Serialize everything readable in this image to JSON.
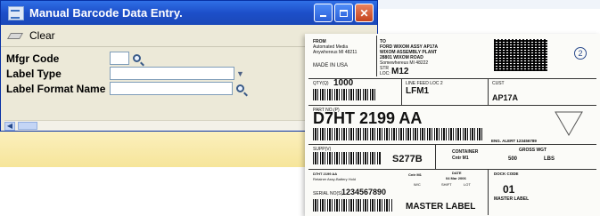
{
  "window": {
    "title": "Manual Barcode Data Entry.",
    "toolbar": {
      "clear_label": "Clear"
    },
    "fields": {
      "mfgr_code_label": "Mfgr Code",
      "label_type_label": "Label Type",
      "label_format_name_label": "Label Format Name"
    }
  },
  "label": {
    "from_head": "FROM",
    "from_line1": "Automated Media",
    "from_line2": "Anywhereus    MI 48211",
    "made_in": "MADE IN USA",
    "to_head": "TO",
    "to_line1": "FORD WIXOM ASSY AP17A",
    "to_line2": "WIXOM ASSEMBLY PLANT",
    "to_line3": "28801 WIXOM ROAD",
    "to_line4": "Somewhereus    MI 48222",
    "str_label": "STR",
    "loc_label": "LOC:",
    "loc_value": "M12",
    "qty_label": "QTY(Q)",
    "qty_value": "1000",
    "linefeed_label": "LINE FEED LOC 2",
    "linefeed_value": "LFM1",
    "cust_label": "CUST",
    "cust_value": "AP17A",
    "partno_label": "PART NO.(P)",
    "partno_value": "D7HT 2199 AA",
    "eng_alert": "ENG. ALERT  123456789",
    "supplier_label": "SUPP(V)",
    "supplier_value": "S277B",
    "container_label": "CONTAINER",
    "container_value": "Cntr   M1",
    "gross_label": "GROSS WGT",
    "gross_value": "500",
    "gross_unit": "LBS",
    "desc_line1": "D7HT 2199 AA",
    "desc_line2": "Retainer Assy-Battery Hold",
    "cntr_small": "Cntr   M1",
    "wc_small": "W/C",
    "date_label": "DATE",
    "date_value": "04 Mar 2006",
    "shift_label": "SHIFT",
    "lot_label": "LOT",
    "serial_label": "SERIAL NO(S)",
    "serial_value": "1234567890",
    "dock_label": "DOCK CODE",
    "dock_value": "01",
    "master_small": "MASTER LABEL",
    "master_big": "MASTER LABEL"
  }
}
